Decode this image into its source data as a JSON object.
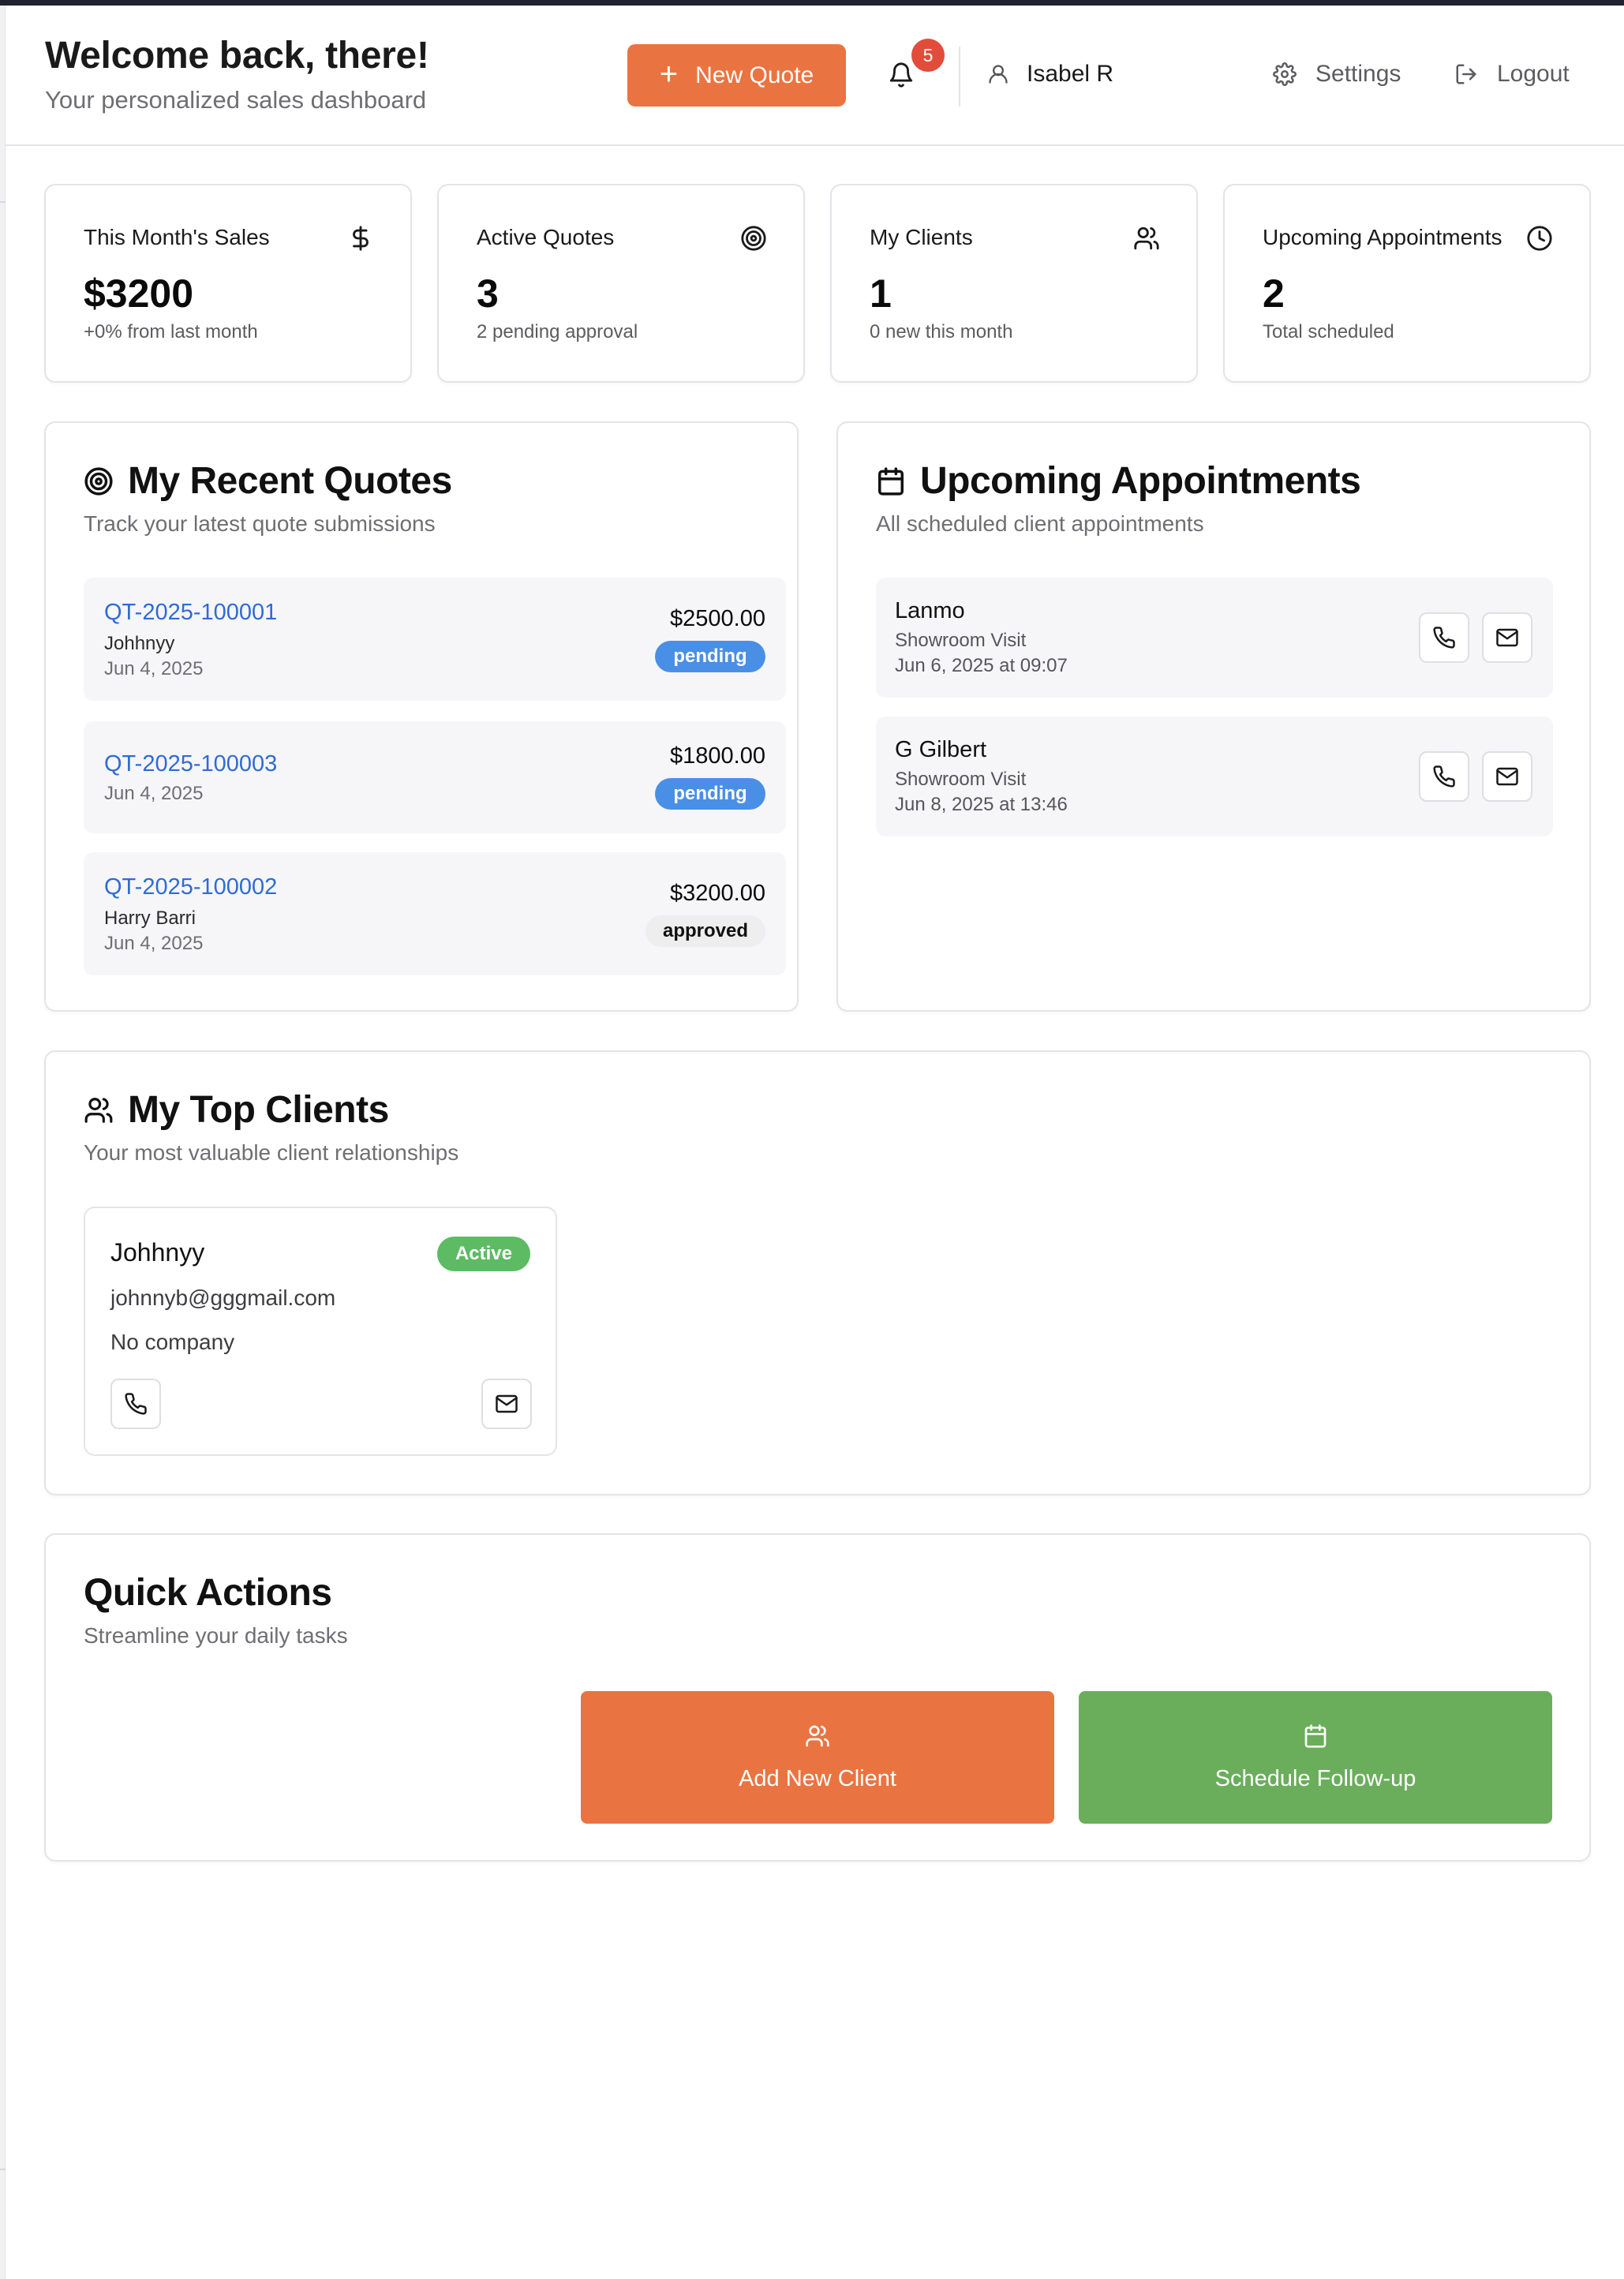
{
  "header": {
    "title": "Welcome back, there!",
    "subtitle": "Your personalized sales dashboard",
    "new_quote_label": "New Quote",
    "notification_count": "5",
    "user_name": "Isabel R",
    "settings_label": "Settings",
    "logout_label": "Logout"
  },
  "stats": [
    {
      "title": "This Month's Sales",
      "value": "$3200",
      "sub": "+0% from last month",
      "icon": "dollar-icon"
    },
    {
      "title": "Active Quotes",
      "value": "3",
      "sub": "2 pending approval",
      "icon": "target-icon"
    },
    {
      "title": "My Clients",
      "value": "1",
      "sub": "0 new this month",
      "icon": "users-icon"
    },
    {
      "title": "Upcoming Appointments",
      "value": "2",
      "sub": "Total scheduled",
      "icon": "clock-icon"
    }
  ],
  "recent_quotes": {
    "title": "My Recent Quotes",
    "subtitle": "Track your latest quote submissions",
    "items": [
      {
        "id": "QT-2025-100001",
        "client": "Johhnyy",
        "date": "Jun 4, 2025",
        "amount": "$2500.00",
        "status": "pending"
      },
      {
        "id": "QT-2025-100003",
        "client": "",
        "date": "Jun 4, 2025",
        "amount": "$1800.00",
        "status": "pending"
      },
      {
        "id": "QT-2025-100002",
        "client": "Harry Barri",
        "date": "Jun 4, 2025",
        "amount": "$3200.00",
        "status": "approved"
      }
    ]
  },
  "appointments": {
    "title": "Upcoming Appointments",
    "subtitle": "All scheduled client appointments",
    "items": [
      {
        "name": "Lanmo",
        "type": "Showroom Visit",
        "when": "Jun 6, 2025 at 09:07"
      },
      {
        "name": "G Gilbert",
        "type": "Showroom Visit",
        "when": "Jun 8, 2025 at 13:46"
      }
    ]
  },
  "top_clients": {
    "title": "My Top Clients",
    "subtitle": "Your most valuable client relationships",
    "items": [
      {
        "name": "Johhnyy",
        "status": "Active",
        "email": "johnnyb@gggmail.com",
        "company": "No company"
      }
    ]
  },
  "quick_actions": {
    "title": "Quick Actions",
    "subtitle": "Streamline your daily tasks",
    "add_client_label": "Add New Client",
    "schedule_label": "Schedule Follow-up"
  },
  "colors": {
    "accent_orange": "#ea7441",
    "accent_green": "#6aae5c",
    "pending_blue": "#4a8fe6",
    "active_green": "#5dbb63",
    "badge_red": "#e24c3a",
    "link_blue": "#2f6bd6"
  }
}
